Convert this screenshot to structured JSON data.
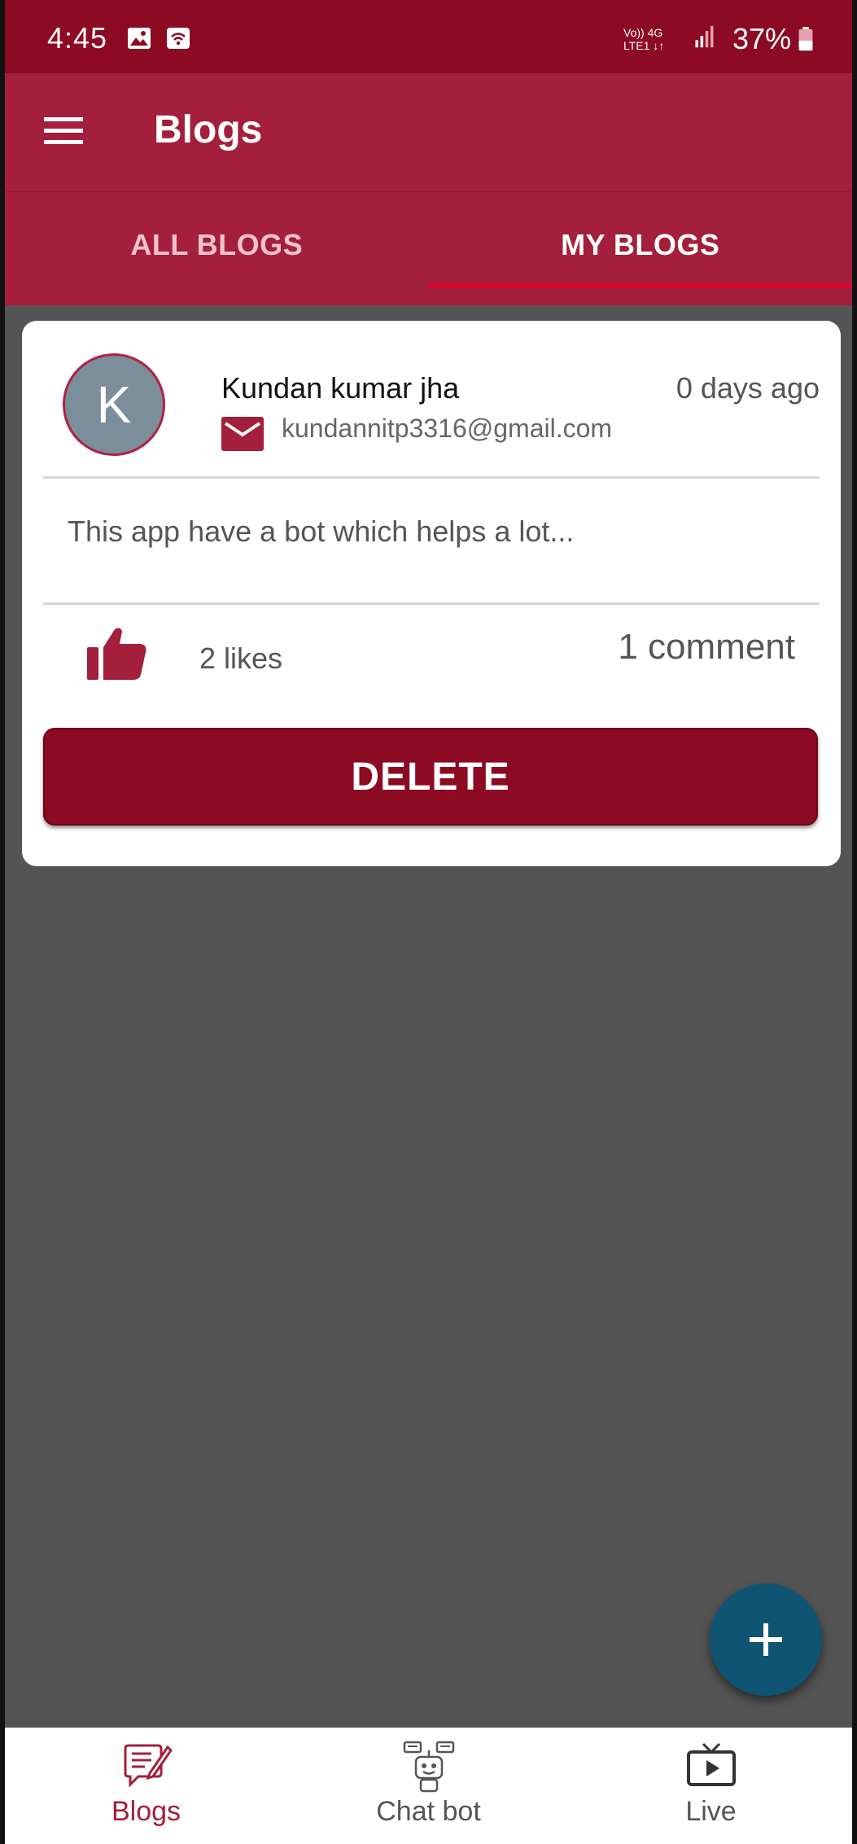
{
  "status_bar": {
    "time": "4:45",
    "battery": "37%",
    "network_top": "Vo)) 4G",
    "network_bottom": "LTE1 ↓↑"
  },
  "app_bar": {
    "title": "Blogs",
    "menu_icon": "hamburger-menu-icon"
  },
  "tabs": [
    {
      "label": "ALL BLOGS",
      "active": false
    },
    {
      "label": "MY BLOGS",
      "active": true
    }
  ],
  "post": {
    "avatar_letter": "K",
    "author": "Kundan kumar jha",
    "email": "kundannitp3316@gmail.com",
    "time": "0 days ago",
    "body": "This app have a bot which helps a lot...",
    "likes": "2 likes",
    "comments": "1 comment",
    "delete_label": "DELETE"
  },
  "fab": {
    "icon": "plus-icon"
  },
  "bottom_nav": [
    {
      "label": "Blogs",
      "icon": "blog-icon",
      "active": true
    },
    {
      "label": "Chat bot",
      "icon": "robot-icon",
      "active": false
    },
    {
      "label": "Live",
      "icon": "tv-icon",
      "active": false
    }
  ],
  "colors": {
    "primary": "#a31f3b",
    "status_bar": "#8c0a22",
    "fab": "#0f5473",
    "background": "#545454"
  }
}
